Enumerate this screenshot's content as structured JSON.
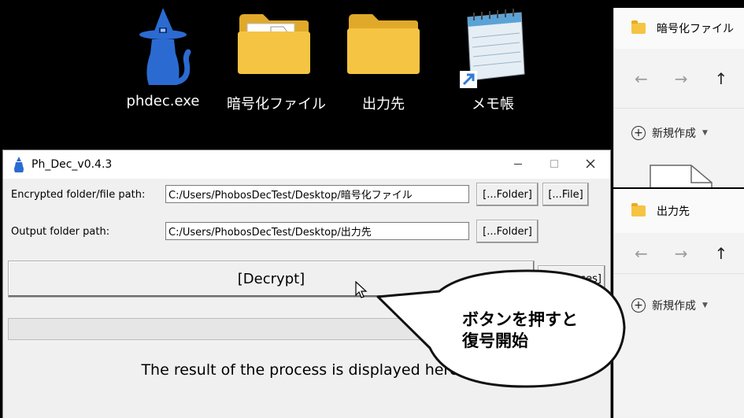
{
  "desktop": {
    "icons": [
      {
        "label": "phdec.exe",
        "icon": "wizard-cat-icon"
      },
      {
        "label": "暗号化ファイル",
        "icon": "folder-with-document-icon"
      },
      {
        "label": "出力先",
        "icon": "folder-icon"
      },
      {
        "label": "メモ帳",
        "icon": "notepad-icon"
      }
    ]
  },
  "explorer_windows": [
    {
      "title": "暗号化ファイル",
      "new_label": "新規作成"
    },
    {
      "title": "出力先",
      "new_label": "新規作成"
    }
  ],
  "app": {
    "title": "Ph_Dec_v0.4.3",
    "encrypted_label": "Encrypted folder/file path:",
    "encrypted_path": "C:/Users/PhobosDecTest/Desktop/暗号化ファイル",
    "output_label": "Output folder path:",
    "output_path": "C:/Users/PhobosDecTest/Desktop/出力先",
    "folder_button": "[...Folder]",
    "file_button": "[...File]",
    "decrypt_button": "[Decrypt]",
    "licenses_button": "[Licenses]",
    "progress": 0,
    "result_text": "The result of the process is displayed here."
  },
  "callout": {
    "line1": "ボタンを押すと",
    "line2": "復号開始"
  },
  "colors": {
    "wizard_blue": "#2b6bd1",
    "folder_yellow": "#f6c443",
    "desktop_bg": "#000000"
  }
}
